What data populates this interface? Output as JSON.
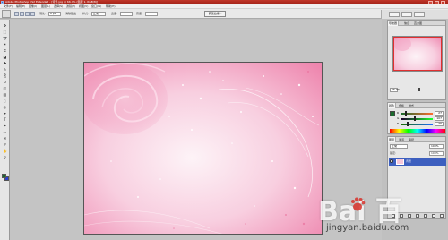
{
  "window": {
    "title": "Adobe Photoshop CS2 Extended - [背景.jpg @ 66.7% (图层 1, RGB/8)]",
    "buttons": [
      "minimize",
      "maximize",
      "close"
    ]
  },
  "menubar": {
    "items": [
      "文件(F)",
      "编辑(E)",
      "图像(I)",
      "图层(L)",
      "选择(S)",
      "滤镜(T)",
      "视图(V)",
      "窗口(W)",
      "帮助(H)"
    ]
  },
  "options": {
    "feather_label": "羽化:",
    "feather_value": "0 px",
    "antialias_label": "消除锯齿",
    "style_label": "样式:",
    "style_value": "正常",
    "width_label": "宽度:",
    "height_label": "高度:",
    "refine_button": "调整边缘..."
  },
  "navigator": {
    "tabs": [
      "导航器",
      "信息",
      "直方图"
    ],
    "zoom_value": "66.7%",
    "zoom_level": 0.45
  },
  "color": {
    "tabs": [
      "颜色",
      "色板",
      "样式"
    ],
    "channels": [
      {
        "label": "R",
        "value": "27",
        "fraction": 0.11
      },
      {
        "label": "G",
        "value": "107",
        "fraction": 0.42
      },
      {
        "label": "B",
        "value": "46",
        "fraction": 0.18
      }
    ]
  },
  "layers": {
    "tabs": [
      "图层",
      "通道",
      "路径"
    ],
    "blend_mode": "正常",
    "opacity": "100%",
    "lock_label": "锁定:",
    "fill": "100%",
    "layer_name": "背景"
  },
  "watermark": {
    "logo": "Bai 百",
    "sub": "jingyan.baidu.com"
  },
  "icons": {
    "tools": [
      "move-icon",
      "marquee-icon",
      "lasso-icon",
      "magic-wand-icon",
      "crop-icon",
      "slice-icon",
      "healing-brush-icon",
      "brush-icon",
      "clone-stamp-icon",
      "history-brush-icon",
      "eraser-icon",
      "gradient-icon",
      "blur-icon",
      "dodge-icon",
      "path-select-icon",
      "type-icon",
      "pen-icon",
      "shape-icon",
      "notes-icon",
      "eyedropper-icon",
      "hand-icon",
      "zoom-icon"
    ]
  },
  "colors": {
    "canvas_bg": "#c4c4c4",
    "foreground": "#1b6b2e",
    "background": "#2a3fd0",
    "selection": "#3d5fbf"
  }
}
